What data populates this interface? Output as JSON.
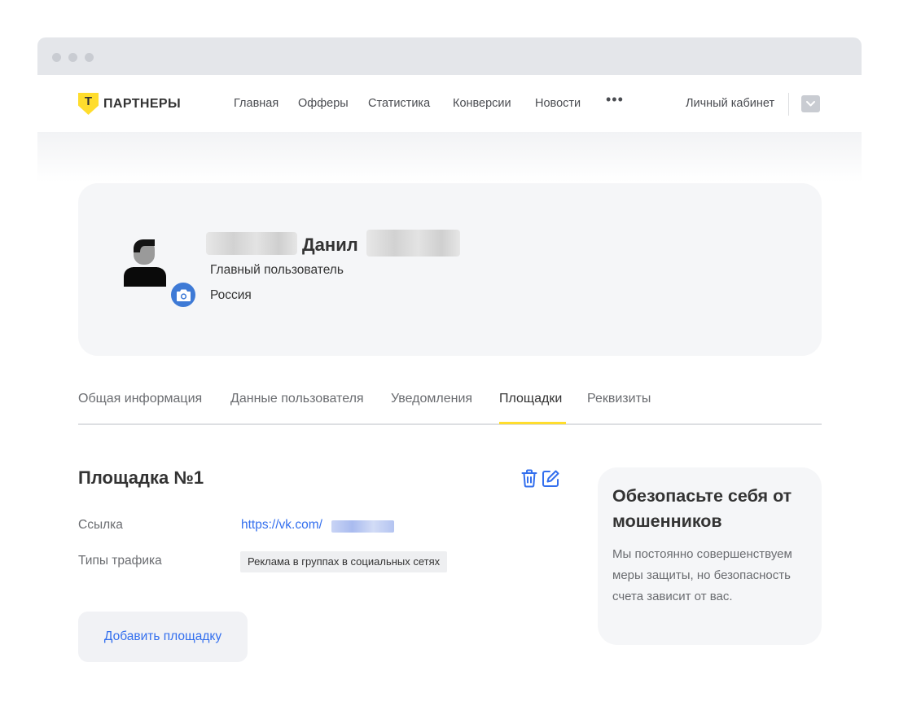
{
  "header": {
    "logo_letter": "Т",
    "logo_text": "ПАРТНЕРЫ",
    "nav": [
      "Главная",
      "Офферы",
      "Статистика",
      "Конверсии",
      "Новости"
    ],
    "more": "•••",
    "cabinet": "Личный кабинет"
  },
  "profile": {
    "name": "Данил",
    "role": "Главный пользователь",
    "country": "Россия"
  },
  "tabs": [
    "Общая информация",
    "Данные пользователя",
    "Уведомления",
    "Площадки",
    "Реквизиты"
  ],
  "active_tab": "Площадки",
  "site": {
    "title": "Площадка №1",
    "link_label": "Ссылка",
    "link_value": "https://vk.com/",
    "traffic_label": "Типы трафика",
    "traffic_value": "Реклама в группах в социальных сетях"
  },
  "add_button": "Добавить площадку",
  "safety": {
    "title": "Обезопасьте себя от мошенников",
    "text": "Мы постоянно совершенствуем меры защиты, но безопасность счета зависит от вас."
  },
  "colors": {
    "brand": "#ffdd2d",
    "link": "#336fee",
    "camera": "#3e7ad6"
  }
}
